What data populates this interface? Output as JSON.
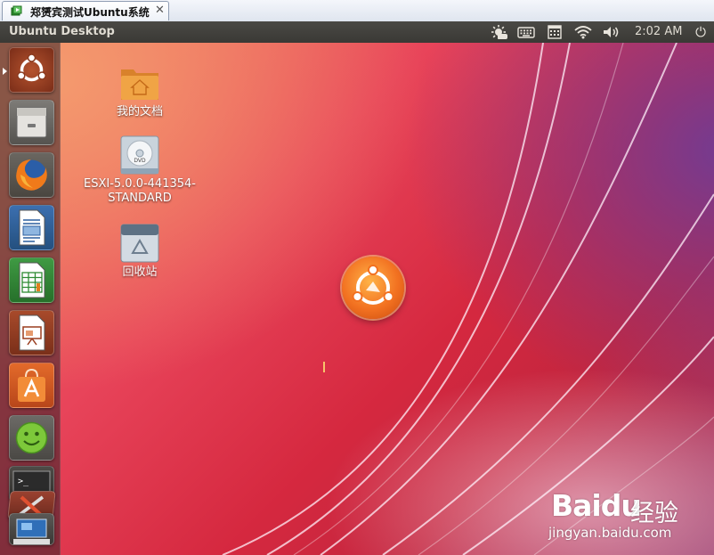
{
  "vm_tab": {
    "title": "郑赟宾测试Ubuntu系统",
    "close_glyph": "✕"
  },
  "panel": {
    "app_title": "Ubuntu Desktop",
    "clock": "2:02 AM",
    "indicators": [
      "weather-sun-icon",
      "keyboard-icon",
      "calendar-icon",
      "wifi-icon",
      "volume-icon"
    ],
    "session_glyph": "⏻"
  },
  "launcher": {
    "items": [
      {
        "name": "dash-home",
        "icon": "ubuntu-logo-icon"
      },
      {
        "name": "files",
        "icon": "file-cabinet-icon"
      },
      {
        "name": "firefox",
        "icon": "firefox-icon"
      },
      {
        "name": "writer",
        "icon": "document-icon"
      },
      {
        "name": "calc",
        "icon": "spreadsheet-icon"
      },
      {
        "name": "impress",
        "icon": "presentation-icon"
      },
      {
        "name": "software-center",
        "icon": "shopping-bag-icon"
      },
      {
        "name": "ubuntu-one",
        "icon": "smiley-icon"
      },
      {
        "name": "terminal",
        "icon": "terminal-icon"
      },
      {
        "name": "settings",
        "icon": "tools-icon"
      },
      {
        "name": "workspace",
        "icon": "workspace-icon"
      }
    ],
    "terminal_prompt": ">_"
  },
  "desktop": {
    "icons": [
      {
        "label": "我的文档",
        "icon": "home-folder-icon"
      },
      {
        "label": "ESXI-5.0.0-441354-STANDARD",
        "icon": "dvd-icon",
        "line1": "ESXI-5.0.0-441354-",
        "line2": "STANDARD",
        "disc_label": "DVD"
      },
      {
        "label": "回收站",
        "icon": "trash-icon"
      }
    ],
    "wallpaper_logo": "ubuntu-circle-logo-icon"
  },
  "watermark": {
    "brand": "Bai",
    "paw": "du",
    "cn": "经验",
    "url": "jingyan.baidu.com"
  },
  "colors": {
    "panel_bg": "#3c3b37",
    "launcher_bg": "#4a2a30",
    "accent_orange": "#f27121",
    "wallpaper_red": "#d5283f",
    "wallpaper_purple": "#6e3c96"
  }
}
